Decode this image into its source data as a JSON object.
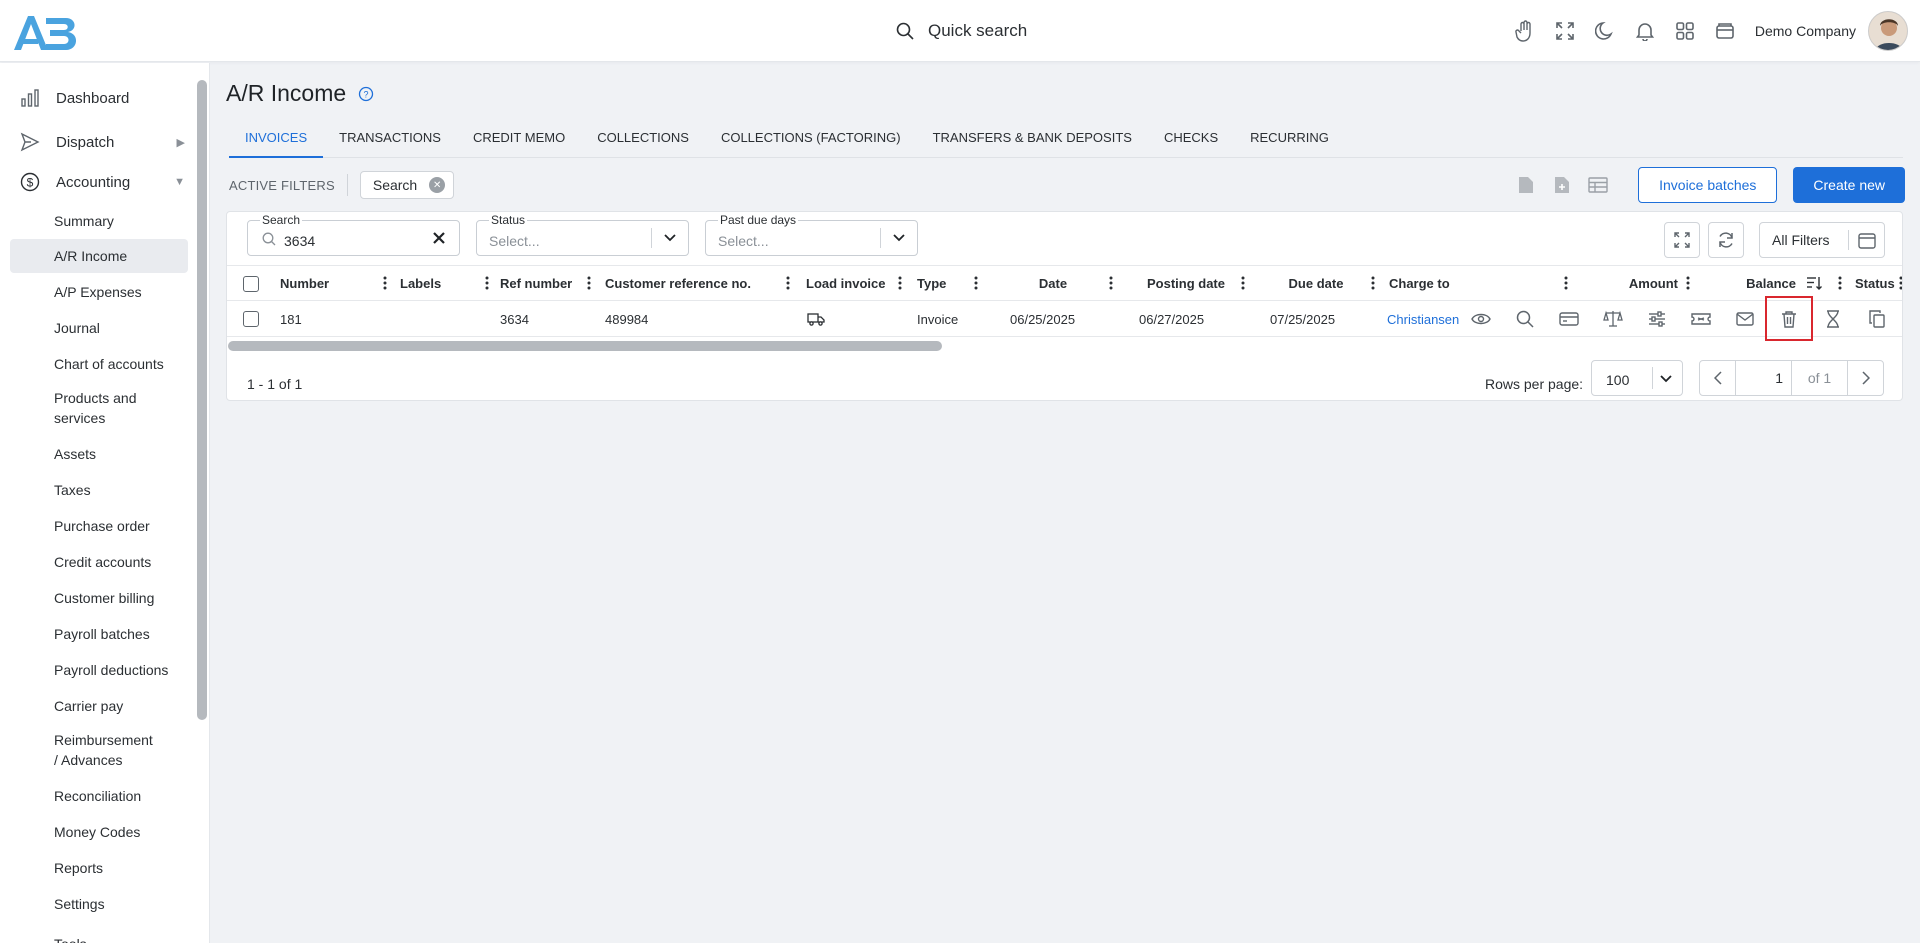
{
  "header": {
    "quick_search_label": "Quick search",
    "company_name": "Demo Company",
    "icons": [
      "hand-icon",
      "fullscreen-icon",
      "moon-icon",
      "bell-icon",
      "apps-grid-icon",
      "wallet-icon"
    ]
  },
  "sidebar": {
    "top_items": [
      {
        "label": "Dashboard",
        "icon": "bar-chart-icon"
      },
      {
        "label": "Dispatch",
        "icon": "send-icon",
        "caret": "▶"
      },
      {
        "label": "Accounting",
        "icon": "dollar-circle-icon",
        "caret": "▼"
      }
    ],
    "sub_items": [
      {
        "label": "Summary"
      },
      {
        "label": "A/R Income",
        "active": true
      },
      {
        "label": "A/P Expenses"
      },
      {
        "label": "Journal"
      },
      {
        "label": "Chart of accounts"
      },
      {
        "label": "Products and services"
      },
      {
        "label": "Assets"
      },
      {
        "label": "Taxes"
      },
      {
        "label": "Purchase order"
      },
      {
        "label": "Credit accounts"
      },
      {
        "label": "Customer billing"
      },
      {
        "label": "Payroll batches"
      },
      {
        "label": "Payroll deductions"
      },
      {
        "label": "Carrier pay"
      },
      {
        "label": "Reimbursement / Advances"
      },
      {
        "label": "Reconciliation"
      },
      {
        "label": "Money Codes"
      },
      {
        "label": "Reports"
      },
      {
        "label": "Settings"
      },
      {
        "label": "Tools"
      }
    ]
  },
  "page": {
    "title": "A/R Income",
    "tabs": [
      "INVOICES",
      "TRANSACTIONS",
      "CREDIT MEMO",
      "COLLECTIONS",
      "COLLECTIONS (FACTORING)",
      "TRANSFERS & BANK DEPOSITS",
      "CHECKS",
      "RECURRING"
    ],
    "active_tab": "INVOICES",
    "active_filters_label": "ACTIVE FILTERS",
    "active_filter_chip": "Search",
    "invoice_batches_label": "Invoice batches",
    "create_new_label": "Create new"
  },
  "filters": {
    "search": {
      "label": "Search",
      "value": "3634"
    },
    "status": {
      "label": "Status",
      "placeholder": "Select..."
    },
    "past_due": {
      "label": "Past due days",
      "placeholder": "Select..."
    },
    "all_filters_label": "All Filters"
  },
  "table": {
    "columns": [
      "Number",
      "Labels",
      "Ref number",
      "Customer reference no.",
      "Load invoice",
      "Type",
      "Date",
      "Posting date",
      "Due date",
      "Charge to",
      "Amount",
      "Balance",
      "Status"
    ],
    "rows": [
      {
        "number": "181",
        "labels": "",
        "ref_number": "3634",
        "customer_ref": "489984",
        "type": "Invoice",
        "date": "06/25/2025",
        "posting_date": "06/27/2025",
        "due_date": "07/25/2025",
        "charge_to": "Christiansen",
        "actions": [
          "eye-icon",
          "search-icon",
          "credit-card-icon",
          "scale-icon",
          "sliders-icon",
          "ticket-icon",
          "mail-icon",
          "trash-icon",
          "hourglass-icon",
          "copy-icon"
        ]
      }
    ]
  },
  "pagination": {
    "count_text": "1 - 1 of 1",
    "rows_per_page_label": "Rows per page:",
    "rows_per_page": "100",
    "current_page": "1",
    "of_pages": "of 1"
  },
  "colors": {
    "accent": "#1e6fd9",
    "highlight": "#d9272e"
  }
}
